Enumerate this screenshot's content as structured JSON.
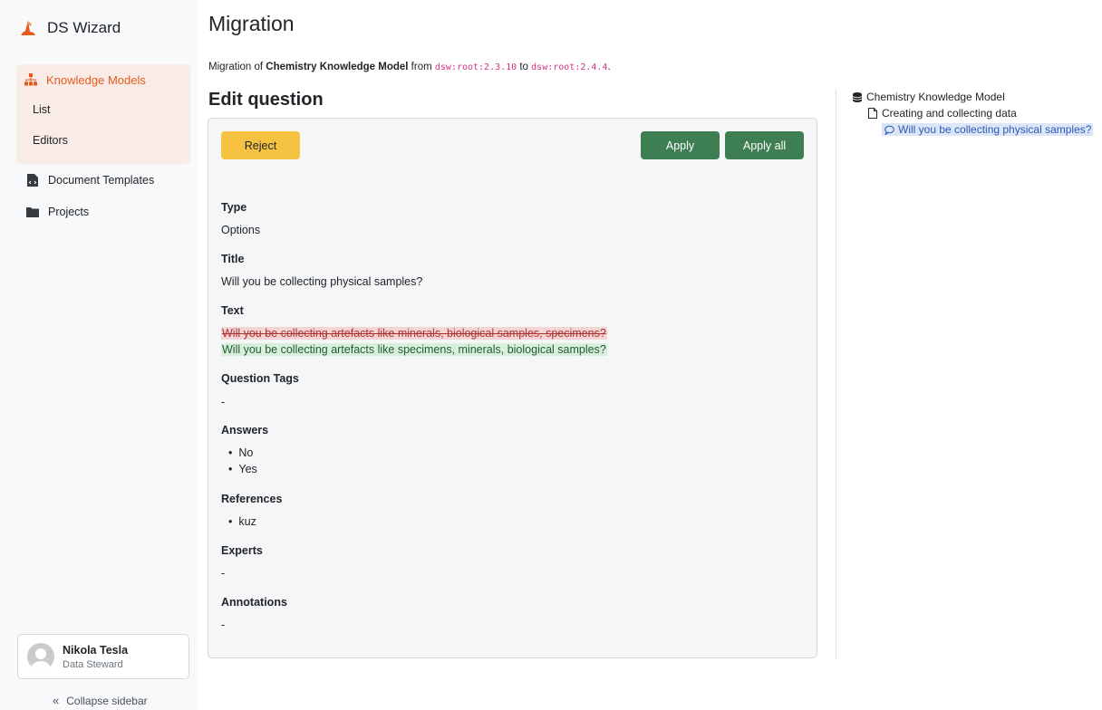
{
  "sidebar": {
    "brand": "DS Wizard",
    "active_group": {
      "label": "Knowledge Models",
      "subitems": [
        "List",
        "Editors"
      ]
    },
    "items": [
      "Document Templates",
      "Projects"
    ],
    "user": {
      "name": "Nikola Tesla",
      "role": "Data Steward"
    },
    "collapse_label": "Collapse sidebar"
  },
  "main": {
    "title": "Migration",
    "migration": {
      "prefix": "Migration of ",
      "km_name": "Chemistry Knowledge Model",
      "from_word": " from ",
      "from_id": "dsw:root:2.3.10",
      "to_word": " to ",
      "to_id": "dsw:root:2.4.4",
      "suffix": "."
    },
    "section_title": "Edit question",
    "buttons": {
      "reject": "Reject",
      "apply": "Apply",
      "apply_all": "Apply all"
    },
    "fields": {
      "type_label": "Type",
      "type_value": "Options",
      "title_label": "Title",
      "title_value": "Will you be collecting physical samples?",
      "text_label": "Text",
      "text_old": "Will you be collecting artefacts like minerals, biological samples, specimens?",
      "text_new": "Will you be collecting artefacts like specimens, minerals, biological samples?",
      "tags_label": "Question Tags",
      "tags_value": "-",
      "answers_label": "Answers",
      "answers": [
        "No",
        "Yes"
      ],
      "references_label": "References",
      "references": [
        "kuz"
      ],
      "experts_label": "Experts",
      "experts_value": "-",
      "annotations_label": "Annotations",
      "annotations_value": "-"
    }
  },
  "tree": {
    "root": "Chemistry Knowledge Model",
    "chapter": "Creating and collecting data",
    "question": "Will you be collecting physical samples?"
  },
  "colors": {
    "accent": "#e65a1e",
    "apply": "#3d7f52",
    "reject": "#f5c242"
  }
}
